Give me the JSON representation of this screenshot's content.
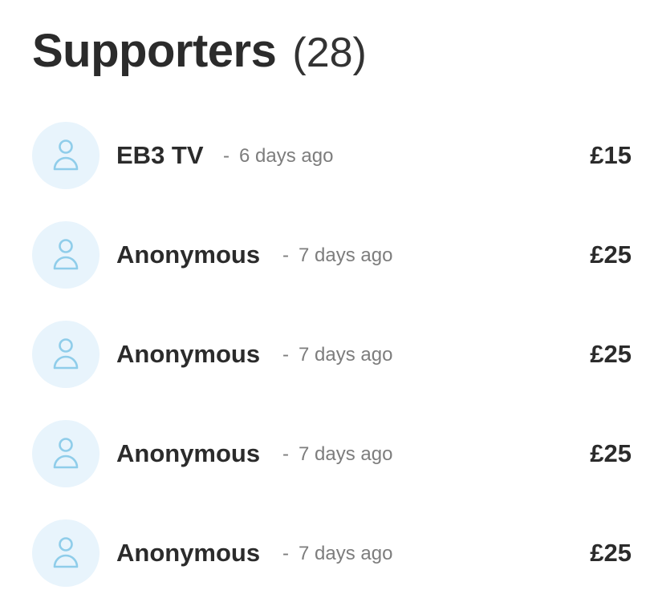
{
  "header": {
    "title": "Supporters",
    "count": "(28)"
  },
  "supporters": [
    {
      "name": "EB3 TV",
      "separator": "-",
      "time": "6 days ago",
      "amount": "£15"
    },
    {
      "name": "Anonymous",
      "separator": "-",
      "time": "7 days ago",
      "amount": "£25"
    },
    {
      "name": "Anonymous",
      "separator": "-",
      "time": "7 days ago",
      "amount": "£25"
    },
    {
      "name": "Anonymous",
      "separator": "-",
      "time": "7 days ago",
      "amount": "£25"
    },
    {
      "name": "Anonymous",
      "separator": "-",
      "time": "7 days ago",
      "amount": "£25"
    }
  ],
  "icons": {
    "avatar": "user-icon"
  },
  "colors": {
    "avatar_background": "#e8f4fc",
    "avatar_icon": "#8fcdea",
    "text_primary": "#2b2b2b",
    "text_secondary": "#7d7d7d"
  }
}
